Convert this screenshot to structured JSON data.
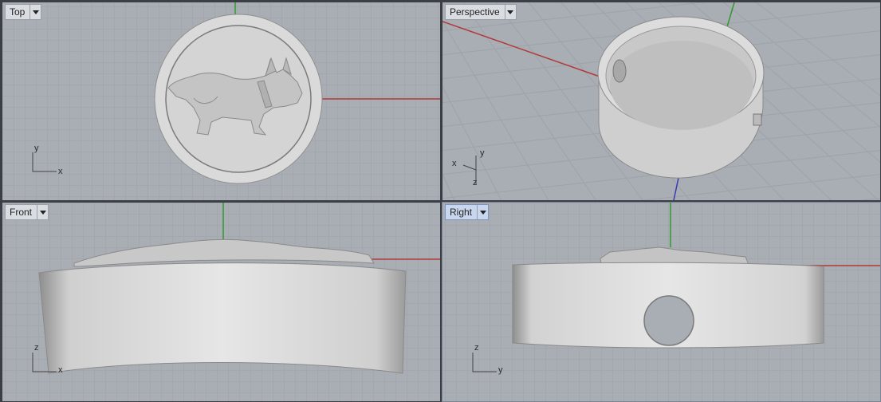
{
  "viewports": {
    "top": {
      "label": "Top",
      "axis_x": "x",
      "axis_y": "y"
    },
    "perspective": {
      "label": "Perspective",
      "axis_x": "x",
      "axis_y": "y",
      "axis_z": "z"
    },
    "front": {
      "label": "Front",
      "axis_x": "x",
      "axis_z": "z"
    },
    "right": {
      "label": "Right",
      "axis_y": "y",
      "axis_z": "z",
      "active": true
    }
  },
  "colors": {
    "viewport_bg": "#a9adb4",
    "grid_minor": "#9da1a8",
    "grid_major": "#8a8e95",
    "x_axis": "#b23a3a",
    "y_axis": "#2f9a2f",
    "z_axis": "#3a3ab5",
    "model": "#d6d6d6"
  }
}
